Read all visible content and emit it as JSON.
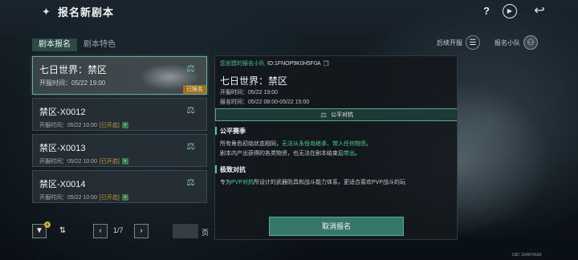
{
  "header": {
    "title": "报名新剧本",
    "logo_icon": "butterfly-logo",
    "help_label": "?",
    "back_icon": "back-arrow-icon"
  },
  "tabs": [
    {
      "label": "剧本报名",
      "active": true
    },
    {
      "label": "剧本特色",
      "active": false
    }
  ],
  "tools": {
    "sort_label": "后续开服",
    "team_label": "报名小队"
  },
  "list": {
    "items": [
      {
        "name": "七日世界：禁区",
        "time": "开服时间：05/22 19:00",
        "status": "",
        "tag": "已报名",
        "selected": true
      },
      {
        "name": "禁区-X0012",
        "time": "开服时间：05/22 10:00",
        "status": "[已开启]",
        "tag": "",
        "selected": false
      },
      {
        "name": "禁区-X0013",
        "time": "开服时间：05/22 10:00",
        "status": "[已开启]",
        "tag": "",
        "selected": false
      },
      {
        "name": "禁区-X0014",
        "time": "开服时间：05/22 10:00",
        "status": "[已开启]",
        "tag": "",
        "selected": false
      }
    ]
  },
  "pager": {
    "current_page": 1,
    "total_pages": 7,
    "indicator": "1/7",
    "suffix": "页",
    "input_value": ""
  },
  "detail": {
    "team_id_label": "您创建的报名小队",
    "team_id_value": "ID:1FNOP9K0H5F0A",
    "title": "七日世界：禁区",
    "open_time": "开服时间：05/22 19:00",
    "signup_time": "报名时间：05/22 08:00-05/22 15:00",
    "mode_label": "公平对抗",
    "section1": {
      "heading": "公平赛季",
      "text1_a": "所有角色初始状态相同，",
      "text1_b": "无法从永恒岛继承、带入任何物资",
      "text1_c": "。",
      "text2_a": "剧本内产出获得的各类物资，也无法在剧本结束后",
      "text2_b": "带出",
      "text2_c": "。"
    },
    "section2": {
      "heading": "极致对抗",
      "text_a": "专为",
      "text_b": "PVP对抗",
      "text_c": "所设计的武器防具和战斗能力体系，更适合喜欢PVP战斗的玩"
    },
    "cancel_label": "取消报名"
  },
  "footer": {
    "uid": "UID: 154674165"
  },
  "colors": {
    "accent": "#4bd08f",
    "selected_border": "#6fa89a",
    "registered_tag": "#9c7220",
    "open_status": "#c79a3a"
  }
}
